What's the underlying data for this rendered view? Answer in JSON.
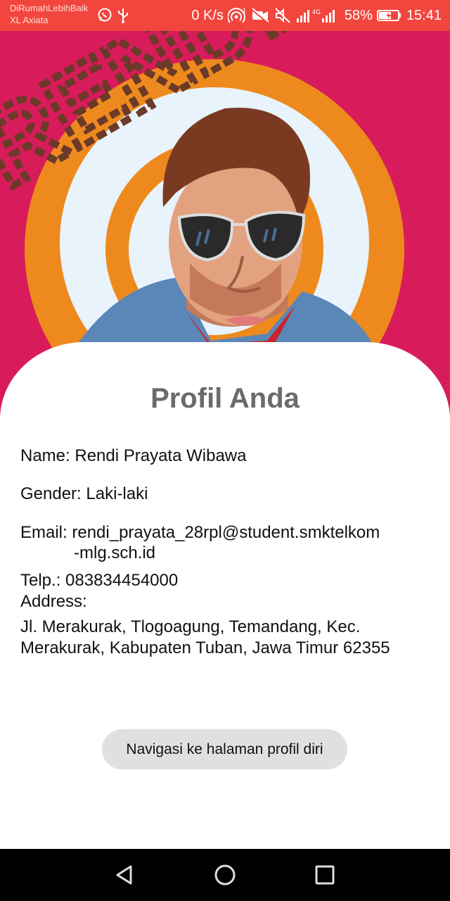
{
  "status_bar": {
    "carrier_line1": "DiRumahLebihBaik",
    "carrier_line2": "XL Axiata",
    "net_speed": "0 K/s",
    "battery": "58%",
    "time": "15:41",
    "network_type": "4G",
    "icons": [
      "whatsapp-icon",
      "usb-icon",
      "hotspot-icon",
      "video-off-icon",
      "mute-icon",
      "signal-icon",
      "battery-icon"
    ]
  },
  "hero": {
    "logo_text": "RENDI",
    "colors": {
      "background": "#d81b5b",
      "outer_ring": "#ee8a1d",
      "inner_ring": "#e8f3fb"
    }
  },
  "profile": {
    "title": "Profil Anda",
    "name": "Name: Rendi Prayata Wibawa",
    "gender": "Gender: Laki-laki",
    "email_line1": "Email: rendi_prayata_28rpl@student.smktelkom",
    "email_line2": "-mlg.sch.id",
    "phone": "Telp.: 083834454000",
    "address_label": "Address:",
    "address_line1": "Jl. Merakurak, Tlogoagung, Temandang, Kec.",
    "address_line2": "Merakurak, Kabupaten Tuban, Jawa Timur 62355"
  },
  "action": {
    "button_label": "Navigasi ke halaman profil diri"
  },
  "nav_bar": {
    "keys": [
      "back-icon",
      "home-icon",
      "recents-icon"
    ]
  }
}
